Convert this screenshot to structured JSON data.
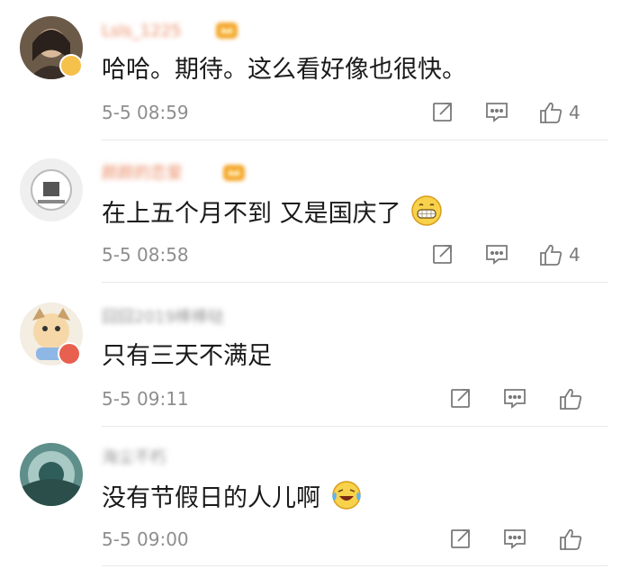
{
  "comments": [
    {
      "username": "Lsls_1225",
      "text": "哈哈。期待。这么看好像也很快。",
      "time": "5-5 08:59",
      "likes": "4",
      "avatar_icon": "user-avatar-photo",
      "username_color": "#e98a63",
      "has_emoji": false
    },
    {
      "username": "颜颜的恋爱",
      "text": "在上五个月不到 又是国庆了",
      "time": "5-5 08:58",
      "likes": "4",
      "avatar_icon": "user-avatar-sketch",
      "username_color": "#e98a63",
      "has_emoji": true,
      "emoji": "grin-emoji"
    },
    {
      "username": "囧囧2019棒棒哒",
      "text": "只有三天不满足",
      "time": "5-5 09:11",
      "likes": "",
      "avatar_icon": "user-avatar-cartoon",
      "username_color": "#9a9a9a",
      "has_emoji": false
    },
    {
      "username": "海尘不朽",
      "text": "没有节假日的人儿啊",
      "time": "5-5 09:00",
      "likes": "",
      "avatar_icon": "user-avatar-landscape",
      "username_color": "#9a9a9a",
      "has_emoji": true,
      "emoji": "laugh-cry-emoji"
    }
  ],
  "icons": {
    "repost": "repost-icon",
    "comment": "comment-icon",
    "like": "thumbs-up-icon"
  },
  "colors": {
    "text": "#1a1a1a",
    "meta": "#8e8e8e",
    "accent_name": "#e98a63",
    "gray_name": "#9a9a9a"
  }
}
